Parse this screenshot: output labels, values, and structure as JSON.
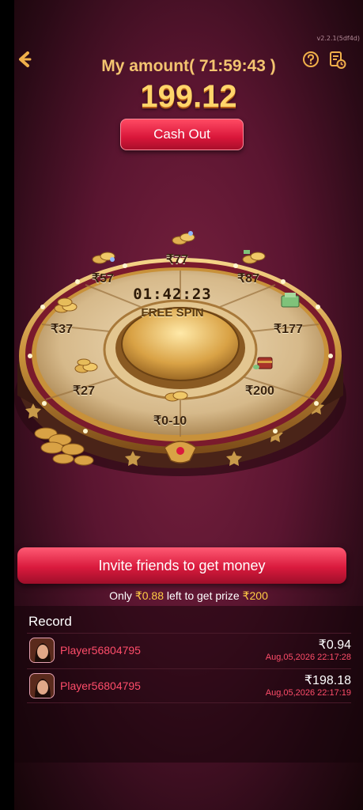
{
  "header": {
    "version": "v2.2.1(5df4d)",
    "title_prefix": "My amount",
    "countdown": "( 71:59:43 )",
    "amount": "199.12",
    "cashout_label": "Cash Out",
    "back_icon": "chevron-left-icon",
    "help_icon": "question-circle-icon",
    "history_icon": "history-icon"
  },
  "wheel": {
    "timer": "01:42:23",
    "center_label": "FREE SPIN",
    "prizes": [
      "₹77",
      "₹87",
      "₹177",
      "₹200",
      "₹0-10",
      "₹27",
      "₹37",
      "₹57"
    ]
  },
  "invite": {
    "button_label": "Invite friends to get money",
    "progress_prefix": "Only ",
    "remaining": "₹0.88",
    "progress_middle": " left to get prize ",
    "prize": "₹200"
  },
  "record": {
    "title": "Record",
    "items": [
      {
        "player": "Player56804795",
        "amount": "₹0.94",
        "time": "Aug,05,2026 22:17:28"
      },
      {
        "player": "Player56804795",
        "amount": "₹198.18",
        "time": "Aug,05,2026 22:17:19"
      }
    ]
  },
  "colors": {
    "accent_red": "#d9163a",
    "gold": "#f3c470",
    "highlight_yellow": "#ffcc44",
    "player_red": "#ff4d6a"
  }
}
